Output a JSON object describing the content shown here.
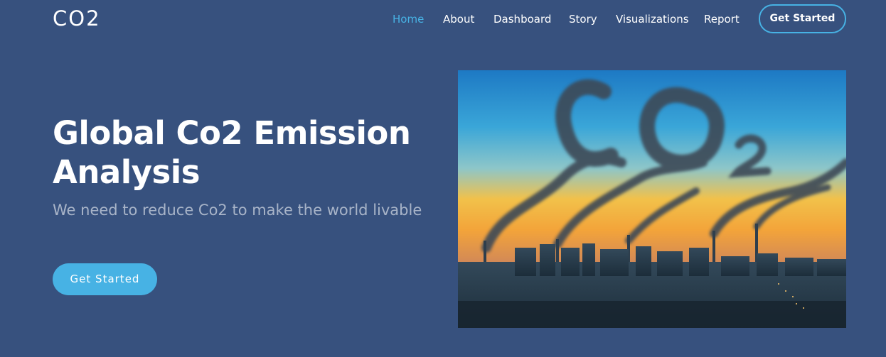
{
  "header": {
    "logo": "CO2",
    "nav": [
      {
        "label": "Home",
        "active": true
      },
      {
        "label": "About",
        "active": false
      },
      {
        "label": "Dashboard",
        "active": false
      },
      {
        "label": "Story",
        "active": false
      },
      {
        "label": "Visualizations",
        "active": false
      },
      {
        "label": "Report",
        "active": false
      }
    ],
    "cta_label": "Get Started"
  },
  "hero": {
    "title": "Global Co2 Emission Analysis",
    "subtitle": "We need to reduce Co2 to make the world livable",
    "cta_label": "Get Started",
    "image": {
      "subject": "factory-smoke-forming-co2-over-city-skyline"
    }
  },
  "colors": {
    "background": "#37517e",
    "accent": "#47b2e4",
    "text": "#ffffff",
    "subtitle": "#a8b4c8"
  }
}
